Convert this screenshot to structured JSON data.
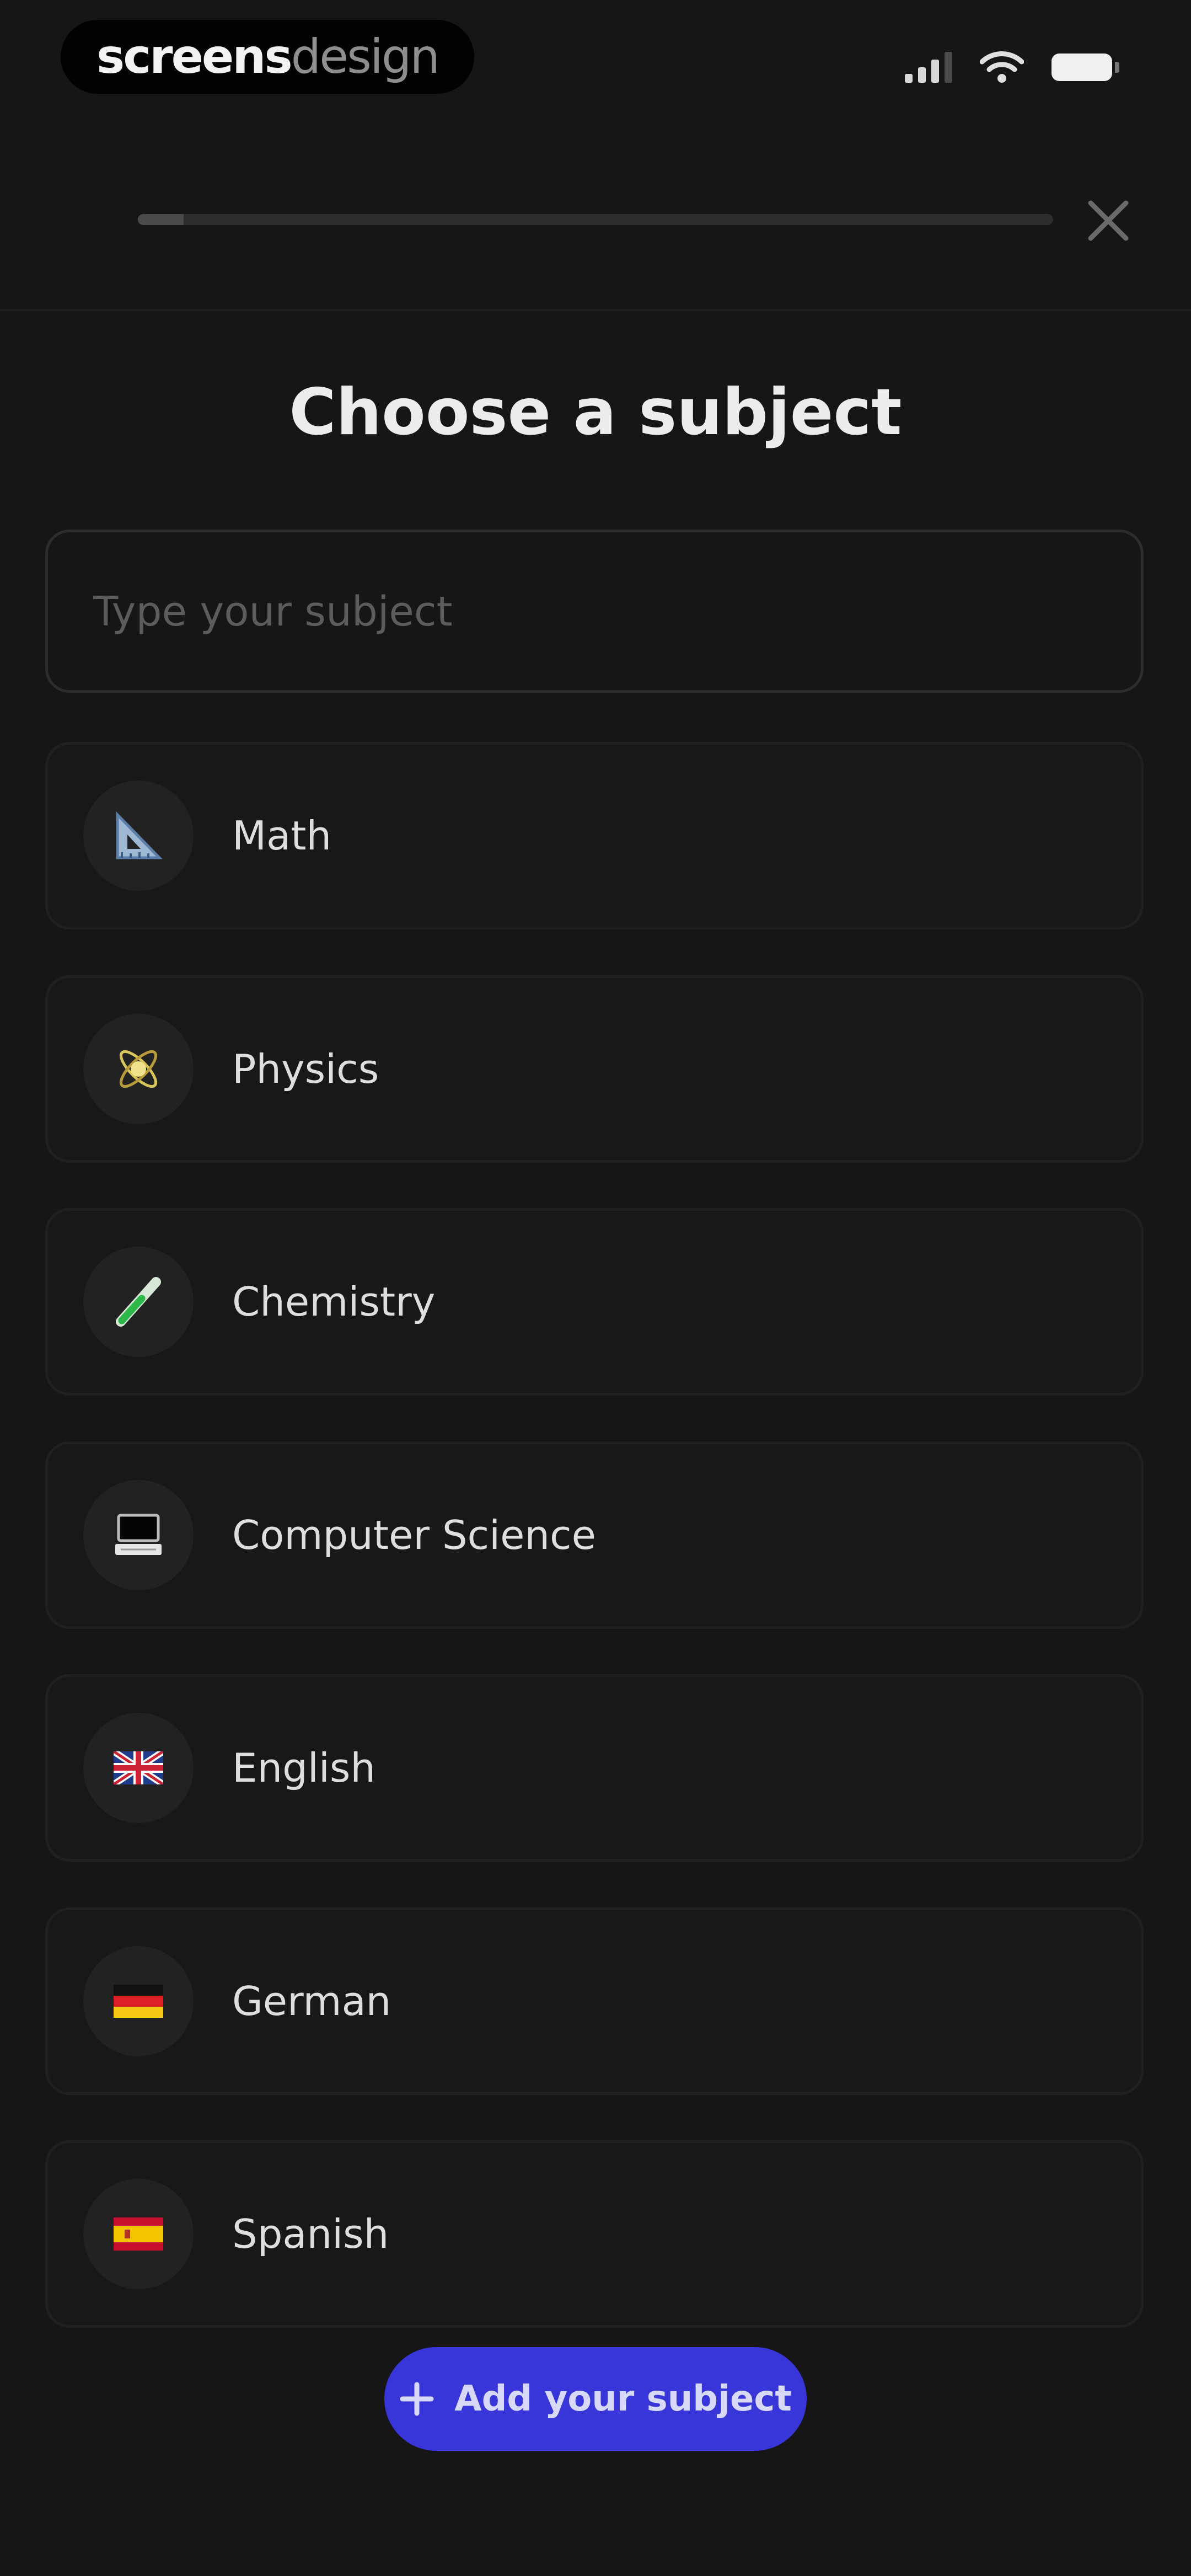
{
  "status_bar": {
    "brand_part1": "screens",
    "brand_part2": "design"
  },
  "header": {
    "progress": 0.05,
    "close_icon": "close-icon"
  },
  "title": "Choose a subject",
  "search": {
    "placeholder": "Type your subject",
    "value": ""
  },
  "subjects": [
    {
      "label": "Math",
      "icon": "triangle-ruler-icon"
    },
    {
      "label": "Physics",
      "icon": "atom-icon"
    },
    {
      "label": "Chemistry",
      "icon": "test-tube-icon"
    },
    {
      "label": "Computer Science",
      "icon": "computer-icon"
    },
    {
      "label": "English",
      "icon": "uk-flag-icon"
    },
    {
      "label": "German",
      "icon": "germany-flag-icon"
    },
    {
      "label": "Spanish",
      "icon": "spain-flag-icon"
    }
  ],
  "add_button": {
    "label": "Add your subject",
    "icon": "plus-icon"
  },
  "colors": {
    "background": "#161616",
    "accent": "#3836d8",
    "card": "#181818"
  }
}
